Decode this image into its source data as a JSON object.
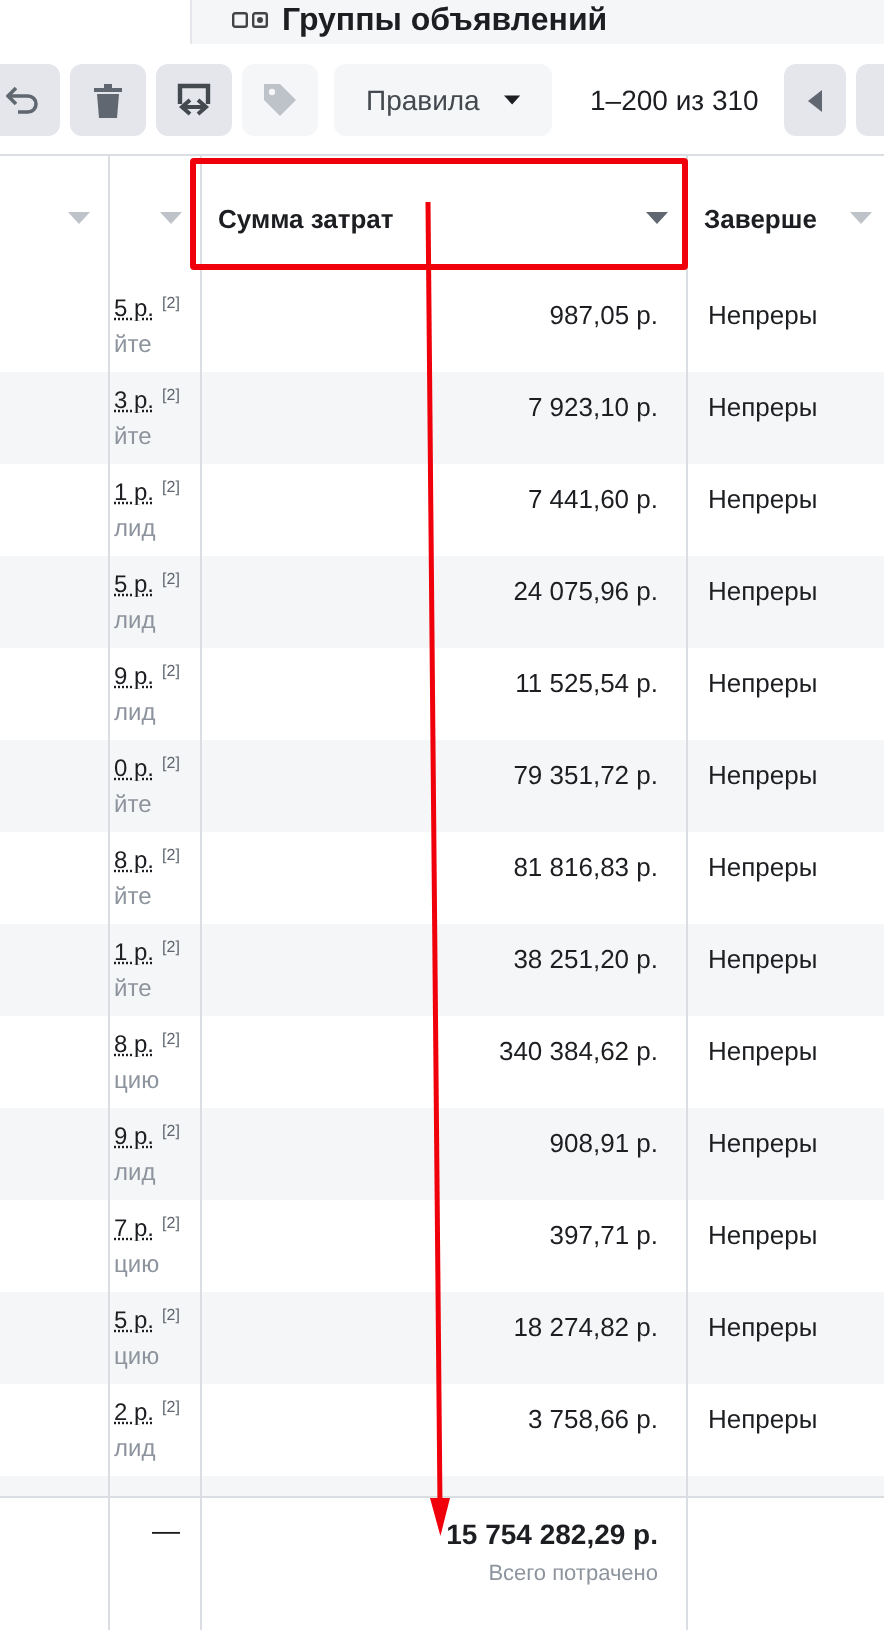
{
  "header": {
    "title": "Группы объявлений"
  },
  "toolbar": {
    "icon_buttons": [
      {
        "kind": "undo",
        "disabled": false
      },
      {
        "kind": "delete",
        "disabled": false
      },
      {
        "kind": "swap",
        "disabled": false
      },
      {
        "kind": "tag",
        "disabled": true
      }
    ],
    "rules_button": {
      "label": "Правила"
    },
    "pagination": "1–200 из 310"
  },
  "table": {
    "columns": [
      {
        "kind": "blank",
        "highlighted": false
      },
      {
        "kind": "blank",
        "highlighted": false
      },
      {
        "kind": "labeled",
        "label": "Сумма затрат",
        "highlighted": true
      },
      {
        "kind": "labeled",
        "label": "Заверше",
        "highlighted": false
      }
    ],
    "rows": [
      {
        "result": "5 р.",
        "footnote": "[2]",
        "result_sub": "йте",
        "spend": "987,05 р.",
        "end": "Непреры"
      },
      {
        "result": "3 р.",
        "footnote": "[2]",
        "result_sub": "йте",
        "spend": "7 923,10 р.",
        "end": "Непреры"
      },
      {
        "result": "1 р.",
        "footnote": "[2]",
        "result_sub": "лид",
        "spend": "7 441,60 р.",
        "end": "Непреры"
      },
      {
        "result": "5 р.",
        "footnote": "[2]",
        "result_sub": "лид",
        "spend": "24 075,96 р.",
        "end": "Непреры"
      },
      {
        "result": "9 р.",
        "footnote": "[2]",
        "result_sub": "лид",
        "spend": "11 525,54 р.",
        "end": "Непреры"
      },
      {
        "result": "0 р.",
        "footnote": "[2]",
        "result_sub": "йте",
        "spend": "79 351,72 р.",
        "end": "Непреры"
      },
      {
        "result": "8 р.",
        "footnote": "[2]",
        "result_sub": "йте",
        "spend": "81 816,83 р.",
        "end": "Непреры"
      },
      {
        "result": "1 р.",
        "footnote": "[2]",
        "result_sub": "йте",
        "spend": "38 251,20 р.",
        "end": "Непреры"
      },
      {
        "result": "8 р.",
        "footnote": "[2]",
        "result_sub": "цию",
        "spend": "340 384,62 р.",
        "end": "Непреры"
      },
      {
        "result": "9 р.",
        "footnote": "[2]",
        "result_sub": "лид",
        "spend": "908,91 р.",
        "end": "Непреры"
      },
      {
        "result": "7 р.",
        "footnote": "[2]",
        "result_sub": "цию",
        "spend": "397,71 р.",
        "end": "Непреры"
      },
      {
        "result": "5 р.",
        "footnote": "[2]",
        "result_sub": "цию",
        "spend": "18 274,82 р.",
        "end": "Непреры"
      },
      {
        "result": "2 р.",
        "footnote": "[2]",
        "result_sub": "лид",
        "spend": "3 758,66 р.",
        "end": "Непреры"
      }
    ],
    "footer": {
      "result": "—",
      "spend": "15 754 282,29 р.",
      "spend_caption": "Всего потрачено"
    }
  }
}
